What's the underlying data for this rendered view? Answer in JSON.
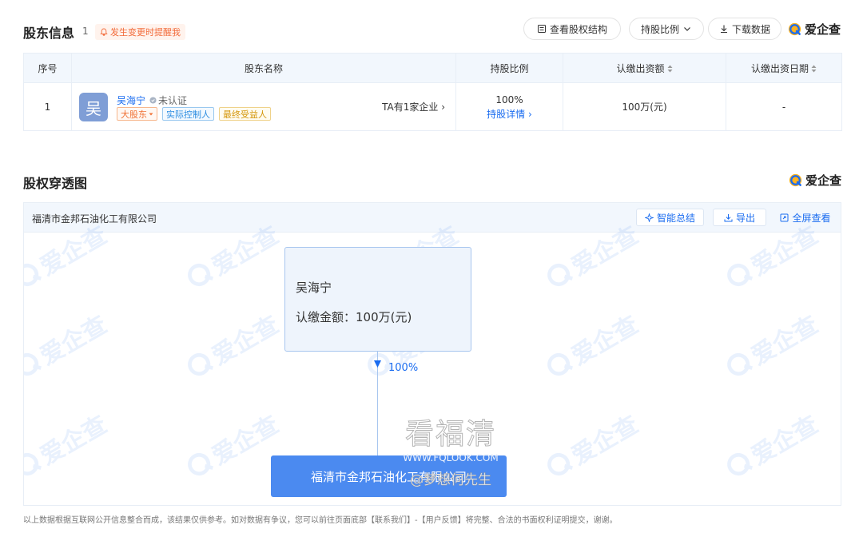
{
  "shareholders": {
    "title": "股东信息",
    "count": "1",
    "remind_label": "发生变更时提醒我",
    "btn_structure": "查看股权结构",
    "btn_ratio": "持股比例",
    "btn_download": "下载数据",
    "brand": "爱企查",
    "columns": [
      "序号",
      "股东名称",
      "持股比例",
      "认缴出资额",
      "认缴出资日期"
    ],
    "rows": [
      {
        "index": "1",
        "avatar_char": "吴",
        "name": "吴海宁",
        "verify_status": "未认证",
        "tags": [
          "大股东",
          "实际控制人",
          "最终受益人"
        ],
        "company_link": "TA有1家企业",
        "ratio": "100%",
        "ratio_detail": "持股详情",
        "amount": "100万(元)",
        "date": "-"
      }
    ]
  },
  "penetration": {
    "title": "股权穿透图",
    "brand": "爱企查",
    "company_name": "福清市金邦石油化工有限公司",
    "btn_summary": "智能总结",
    "btn_export": "导出",
    "btn_fullscreen": "全屏查看",
    "holder_name": "吴海宁",
    "holder_amount": "认缴金额：100万(元)",
    "edge_ratio": "100%",
    "target_company": "福清市金邦石油化工有限公司",
    "watermark_text": "爱企查"
  },
  "overlay": {
    "big": "看福清",
    "url": "WWW.FQLOOK.COM",
    "author": "@梦想何先生"
  },
  "footnote": "以上数据根据互联网公开信息整合而成，该结果仅供参考。如对数据有争议，您可以前往页面底部【联系我们】-【用户反馈】将完整、合法的书面权利证明提交，谢谢。",
  "colors": {
    "accent": "#1a6cf0",
    "node_company": "#4b8af0",
    "tag_major": "#f07236",
    "tag_ctrl": "#2d8de0",
    "tag_ben": "#d4970c"
  }
}
